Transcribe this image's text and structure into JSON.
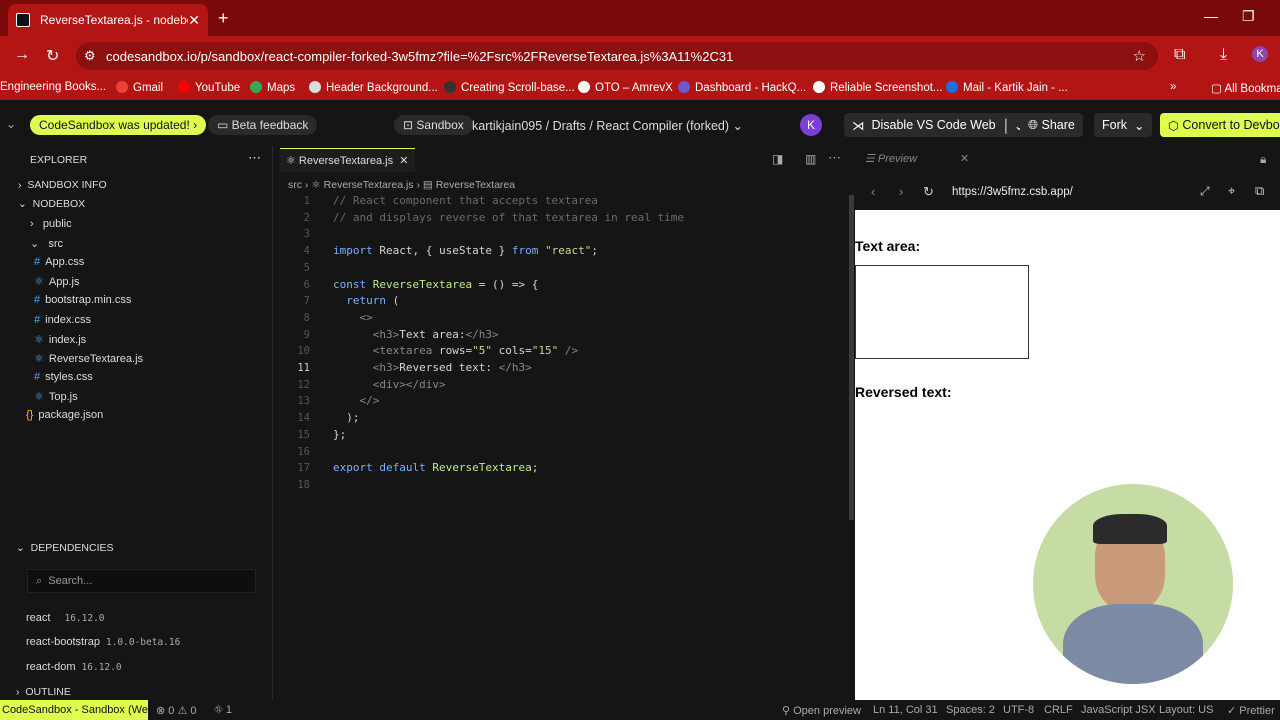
{
  "browser": {
    "tab_title": "ReverseTextarea.js - nodebox - C",
    "url": "codesandbox.io/p/sandbox/react-compiler-forked-3w5fmz?file=%2Fsrc%2FReverseTextarea.js%3A11%2C31",
    "bookmarks": [
      "Engineering Books...",
      "Gmail",
      "YouTube",
      "Maps",
      "Header Background...",
      "Creating Scroll-base...",
      "OTO – AmrevX",
      "Dashboard - HackQ...",
      "Reliable Screenshot...",
      "Mail - Kartik Jain - ...",
      "All Bookmarks"
    ],
    "profile_initial": "K"
  },
  "topbar": {
    "updated_badge": "CodeSandbox was updated!",
    "beta_feedback": "Beta feedback",
    "sandbox_label": "Sandbox",
    "breadcrumb": "kartikjain095 / Drafts / React Compiler (forked)",
    "avatar_initial": "K",
    "disable_vscode": "Disable VS Code Web",
    "share": "Share",
    "fork": "Fork",
    "convert": "Convert to Devbox"
  },
  "explorer": {
    "title": "EXPLORER",
    "sandbox_info": "SANDBOX INFO",
    "root": "NODEBOX",
    "folders": {
      "public": "public",
      "src": "src"
    },
    "files": [
      "App.css",
      "App.js",
      "bootstrap.min.css",
      "index.css",
      "index.js",
      "ReverseTextarea.js",
      "styles.css",
      "Top.js"
    ],
    "package": "package.json",
    "dependencies_title": "DEPENDENCIES",
    "search_placeholder": "Search...",
    "deps": [
      {
        "name": "react",
        "version": "16.12.0"
      },
      {
        "name": "react-bootstrap",
        "version": "1.0.0-beta.16"
      },
      {
        "name": "react-dom",
        "version": "16.12.0"
      }
    ],
    "outline": "OUTLINE"
  },
  "editor": {
    "tab": "ReverseTextarea.js",
    "crumb_src": "src",
    "crumb_file": "ReverseTextarea.js",
    "crumb_symbol": "ReverseTextarea",
    "lines": [
      "// React component that accepts textarea",
      "// and displays reverse of that textarea in real time",
      "",
      "import React, { useState } from \"react\";",
      "",
      "const ReverseTextarea = () => {",
      "  return (",
      "    <>",
      "      <h3>Text area:</h3>",
      "      <textarea rows=\"5\" cols=\"15\" />",
      "      <h3>Reversed text: </h3>",
      "      <div></div>",
      "    </>",
      "  );",
      "};",
      "",
      "export default ReverseTextarea;",
      ""
    ]
  },
  "preview": {
    "tab": "Preview",
    "url": "https://3w5fmz.csb.app/",
    "heading1": "Text area:",
    "heading2": "Reversed text:"
  },
  "status": {
    "left": "CodeSandbox - Sandbox (Web)",
    "problems": "⊗ 0 ⚠ 0",
    "ports": "⛗ 1",
    "open_preview": "Open preview",
    "position": "Ln 11, Col 31",
    "spaces": "Spaces: 2",
    "encoding": "UTF-8",
    "eol": "CRLF",
    "language": "JavaScript JSX",
    "layout": "Layout: US",
    "prettier": "✓ Prettier"
  }
}
